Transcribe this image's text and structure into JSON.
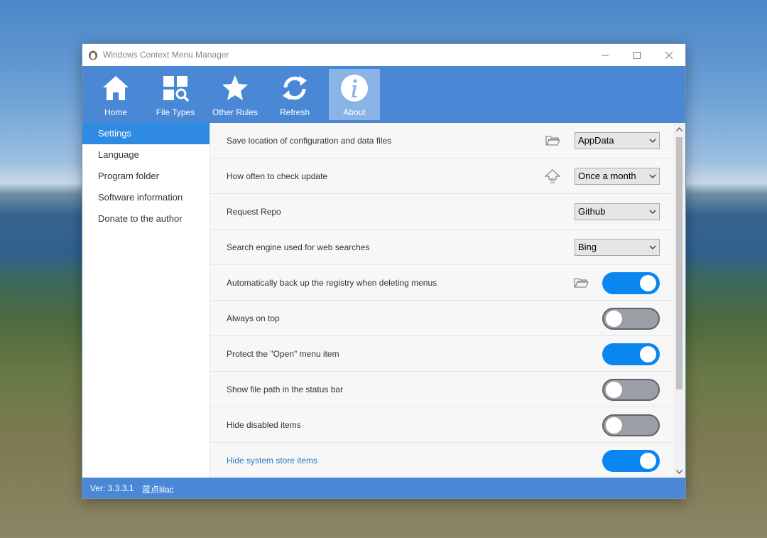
{
  "window": {
    "title": "Windows Context Menu Manager"
  },
  "toolbar": [
    {
      "label": "Home",
      "icon": "home-icon"
    },
    {
      "label": "File Types",
      "icon": "file-types-icon"
    },
    {
      "label": "Other Rules",
      "icon": "star-icon"
    },
    {
      "label": "Refresh",
      "icon": "refresh-icon"
    },
    {
      "label": "About",
      "icon": "info-icon",
      "active": true
    }
  ],
  "sidebar": {
    "items": [
      {
        "label": "Settings",
        "selected": true
      },
      {
        "label": "Language"
      },
      {
        "label": "Program folder"
      },
      {
        "label": "Software information"
      },
      {
        "label": "Donate to the author"
      }
    ]
  },
  "settings": {
    "rows": [
      {
        "label": "Save location of configuration and data files",
        "control": "select",
        "value": "AppData",
        "icon": "folder-icon"
      },
      {
        "label": "How often to check update",
        "control": "select",
        "value": "Once a month",
        "icon": "update-icon"
      },
      {
        "label": "Request Repo",
        "control": "select",
        "value": "Github"
      },
      {
        "label": "Search engine used for web searches",
        "control": "select",
        "value": "Bing"
      },
      {
        "label": "Automatically back up the registry when deleting menus",
        "control": "toggle",
        "on": true,
        "icon": "folder-icon"
      },
      {
        "label": "Always on top",
        "control": "toggle",
        "on": false
      },
      {
        "label": "Protect the \"Open\" menu item",
        "control": "toggle",
        "on": true
      },
      {
        "label": "Show file path in the status bar",
        "control": "toggle",
        "on": false
      },
      {
        "label": "Hide disabled items",
        "control": "toggle",
        "on": false
      },
      {
        "label": "Hide system store items",
        "control": "toggle",
        "on": true,
        "link": true
      }
    ]
  },
  "status": {
    "version": "Ver: 3.3.3.1",
    "author": "蓝点lilac"
  },
  "colors": {
    "accent": "#4a88d6",
    "selection": "#2f8ae1",
    "toggle_on": "#0a86f0",
    "toggle_off": "#9a9fa6"
  }
}
